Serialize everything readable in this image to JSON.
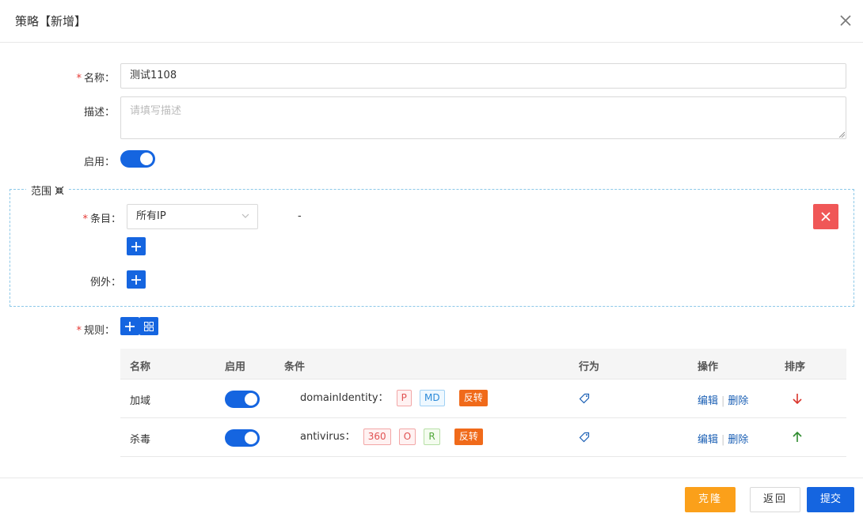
{
  "dialog": {
    "title": "策略【新增】"
  },
  "form": {
    "name_label": "名称：",
    "name_value": "测试1108",
    "desc_label": "描述：",
    "desc_placeholder": "请填写描述",
    "enable_label": "启用："
  },
  "scope": {
    "title": "范围",
    "entry_label": "条目：",
    "entry_select": "所有IP",
    "entry_dash": "-",
    "exception_label": "例外："
  },
  "rules": {
    "label": "规则：",
    "headers": [
      "名称",
      "启用",
      "条件",
      "行为",
      "操作",
      "排序"
    ],
    "rows": [
      {
        "name": "加域",
        "condition_key": "domainIdentity：",
        "tags": [
          "P",
          "MD"
        ],
        "invert": "反转",
        "edit": "编辑",
        "delete": "删除",
        "sort": "down"
      },
      {
        "name": "杀毒",
        "condition_key": "antivirus：",
        "tags": [
          "360",
          "O",
          "R"
        ],
        "invert": "反转",
        "edit": "编辑",
        "delete": "删除",
        "sort": "up"
      }
    ]
  },
  "footer": {
    "clone": "克隆",
    "back": "返回",
    "submit": "提交"
  },
  "colors": {
    "primary": "#1565e0",
    "danger": "#f05757",
    "warning": "#fba01a",
    "invert_tag": "#f06a1a"
  }
}
